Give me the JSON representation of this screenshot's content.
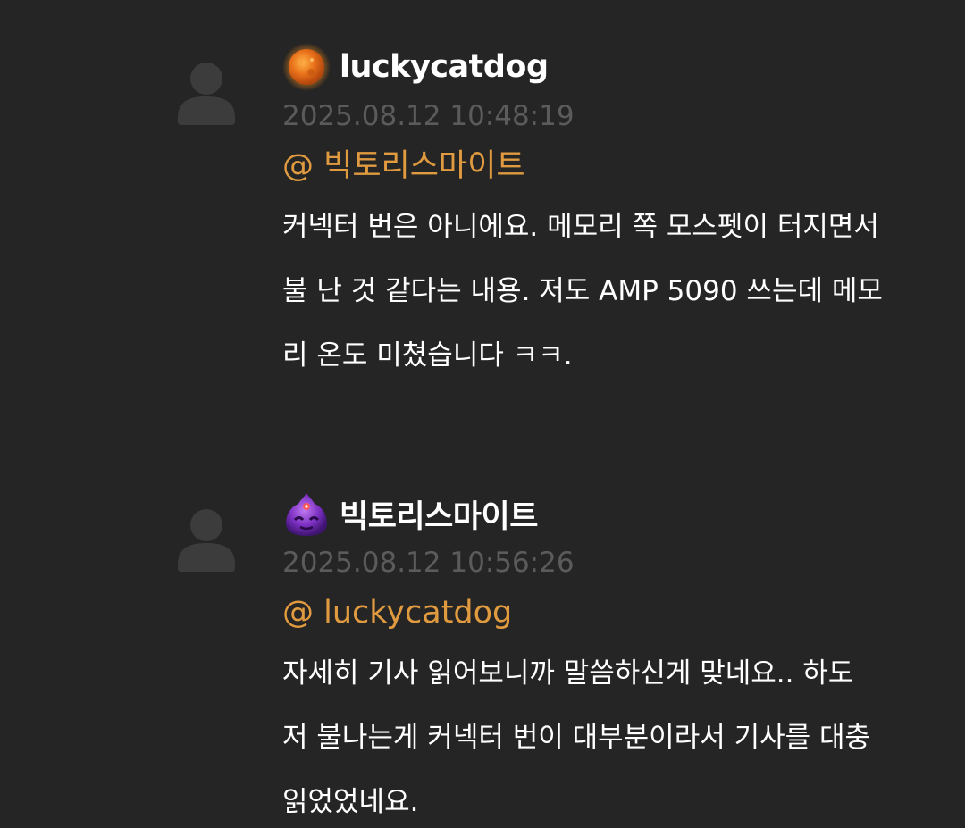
{
  "comments": [
    {
      "level_icon": "sun-badge-icon",
      "username": "luckycatdog",
      "timestamp": "2025.08.12 10:48:19",
      "mention": "@ 빅토리스마이트",
      "lines": [
        "커넥터 번은 아니에요. 메모리 쪽 모스펫이 터지면서",
        "불 난 것 같다는 내용. 저도 AMP 5090 쓰는데 메모",
        "리 온도 미쳤습니다 ㅋㅋ."
      ]
    },
    {
      "level_icon": "purple-slime-badge-icon",
      "username": "빅토리스마이트",
      "timestamp": "2025.08.12 10:56:26",
      "mention": "@ luckycatdog",
      "lines": [
        "자세히 기사 읽어보니까 말씀하신게 맞네요.. 하도",
        "저 불나는게 커넥터 번이 대부분이라서 기사를 대충",
        "읽었었네요."
      ]
    }
  ],
  "colors": {
    "background": "#252525",
    "username": "#ffffff",
    "timestamp": "#5b5b5b",
    "mention": "#e09a3f",
    "avatar_placeholder": "#3c3c3c"
  },
  "icons": {
    "avatar": "user-placeholder-icon"
  }
}
